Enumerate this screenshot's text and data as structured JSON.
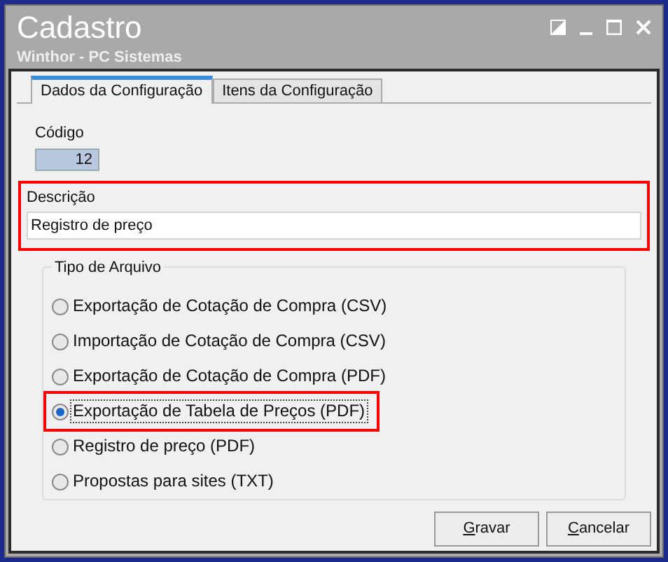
{
  "window": {
    "title": "Cadastro",
    "subtitle": "Winthor - PC Sistemas"
  },
  "tabs": [
    {
      "label": "Dados da Configuração",
      "selected": true
    },
    {
      "label": "Itens da Configuração",
      "selected": false
    }
  ],
  "codigo": {
    "label": "Código",
    "value": "12"
  },
  "descricao": {
    "label": "Descrição",
    "value": "Registro de preço",
    "highlighted": true
  },
  "tipo_arquivo": {
    "title": "Tipo de Arquivo",
    "options": [
      {
        "label": "Exportação de Cotação de Compra (CSV)",
        "selected": false,
        "highlighted": false
      },
      {
        "label": "Importação de Cotação de Compra (CSV)",
        "selected": false,
        "highlighted": false
      },
      {
        "label": "Exportação de Cotação de Compra (PDF)",
        "selected": false,
        "highlighted": false
      },
      {
        "label": "Exportação de Tabela de Preços (PDF)",
        "selected": true,
        "highlighted": true
      },
      {
        "label": "Registro de preço (PDF)",
        "selected": false,
        "highlighted": false
      },
      {
        "label": "Propostas para sites (TXT)",
        "selected": false,
        "highlighted": false
      }
    ]
  },
  "buttons": [
    "Gravar",
    "Cancelar"
  ]
}
